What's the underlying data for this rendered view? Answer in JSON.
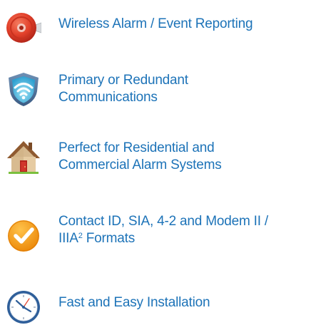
{
  "features": [
    {
      "icon": "alarm-bell-icon",
      "line1": "Wireless Alarm / Event Reporting"
    },
    {
      "icon": "wifi-shield-icon",
      "line1": "Primary or Redundant",
      "line2": "Communications"
    },
    {
      "icon": "house-icon",
      "line1": "Perfect for Residential and",
      "line2": "Commercial Alarm Systems"
    },
    {
      "icon": "checkmark-icon",
      "line1": "Contact ID, SIA, 4-2 and Modem II /",
      "line2_main": "IIIA",
      "line2_sup": "2",
      "line2_end": " Formats"
    },
    {
      "icon": "clock-icon",
      "line1": "Fast and Easy Installation"
    }
  ],
  "colors": {
    "text": "#1d73b8",
    "bell": "#e2402a",
    "shield": "#4b6f97",
    "check": "#f29a16",
    "clock": "#2f5f9a"
  }
}
